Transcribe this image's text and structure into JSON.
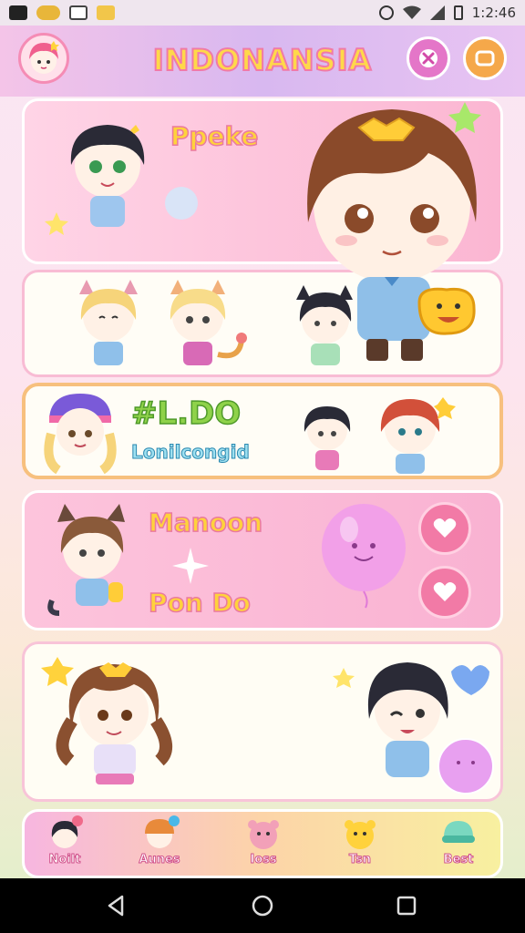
{
  "status_bar": {
    "time": "1:2:46"
  },
  "header": {
    "title": "INDONANSIA"
  },
  "cards": [
    {
      "label": "Ppeke"
    },
    {
      "label": ""
    },
    {
      "label": "#L.DO",
      "sublabel": "Lonilcongid"
    },
    {
      "label": "Manoon",
      "sublabel": "Pon Do"
    },
    {
      "label": ""
    }
  ],
  "bottom_tabs": [
    {
      "label": "Noilt",
      "icon": "girl-avatar-icon"
    },
    {
      "label": "Aunes",
      "icon": "orange-hair-avatar-icon"
    },
    {
      "label": "Ioss",
      "icon": "pink-bear-icon"
    },
    {
      "label": "Tsn",
      "icon": "yellow-bear-icon"
    },
    {
      "label": "Best",
      "icon": "green-cap-icon"
    }
  ],
  "colors": {
    "accent_pink": "#f07aa8",
    "title_yellow": "#ffd84a",
    "header_gradient_start": "#f4c4e8",
    "header_gradient_end": "#e8c4f2"
  }
}
